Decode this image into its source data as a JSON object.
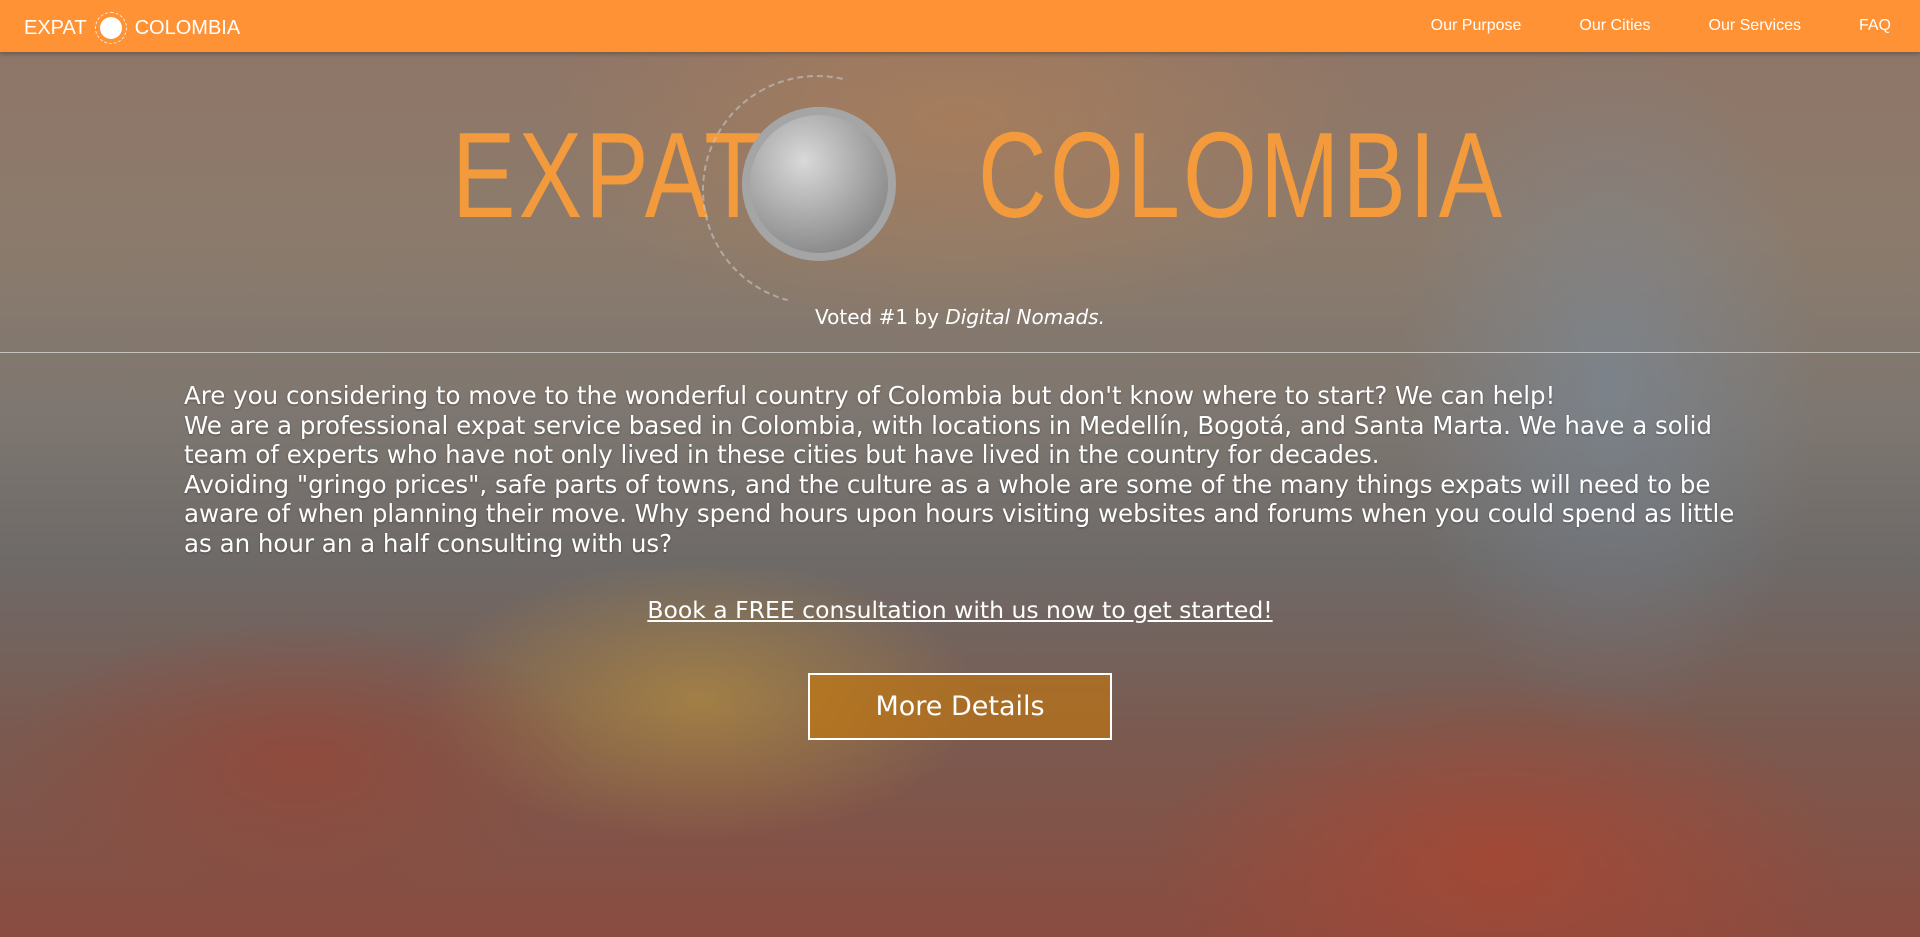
{
  "nav": {
    "brand_left": "EXPAT",
    "brand_right": "COLOMBIA",
    "items": [
      "Our Purpose",
      "Our Cities",
      "Our Services",
      "FAQ"
    ],
    "bg_color": "#ff9234"
  },
  "hero": {
    "logo_left": "EXPAT",
    "logo_right": "COLOMBIA",
    "logo_color": "#f29a3c",
    "voted_prefix": "Voted #1 by ",
    "voted_em": "Digital Nomads.",
    "paragraphs": [
      "Are you considering to move to the wonderful country of Colombia but don't know where to start? We can help!",
      "We are a professional expat service based in Colombia, with locations in Medellín, Bogotá, and Santa Marta. We have a solid team of experts who have not only lived in these cities but have lived in the country for decades.",
      "Avoiding \"gringo prices\", safe parts of towns, and the culture as a whole are some of the many things expats will need to be aware of when planning their move. Why spend hours upon hours visiting websites and forums when you could spend as little as an hour an a half consulting with us?"
    ],
    "cta_link": "Book a FREE consultation with us now to get started!",
    "button": "More Details"
  }
}
